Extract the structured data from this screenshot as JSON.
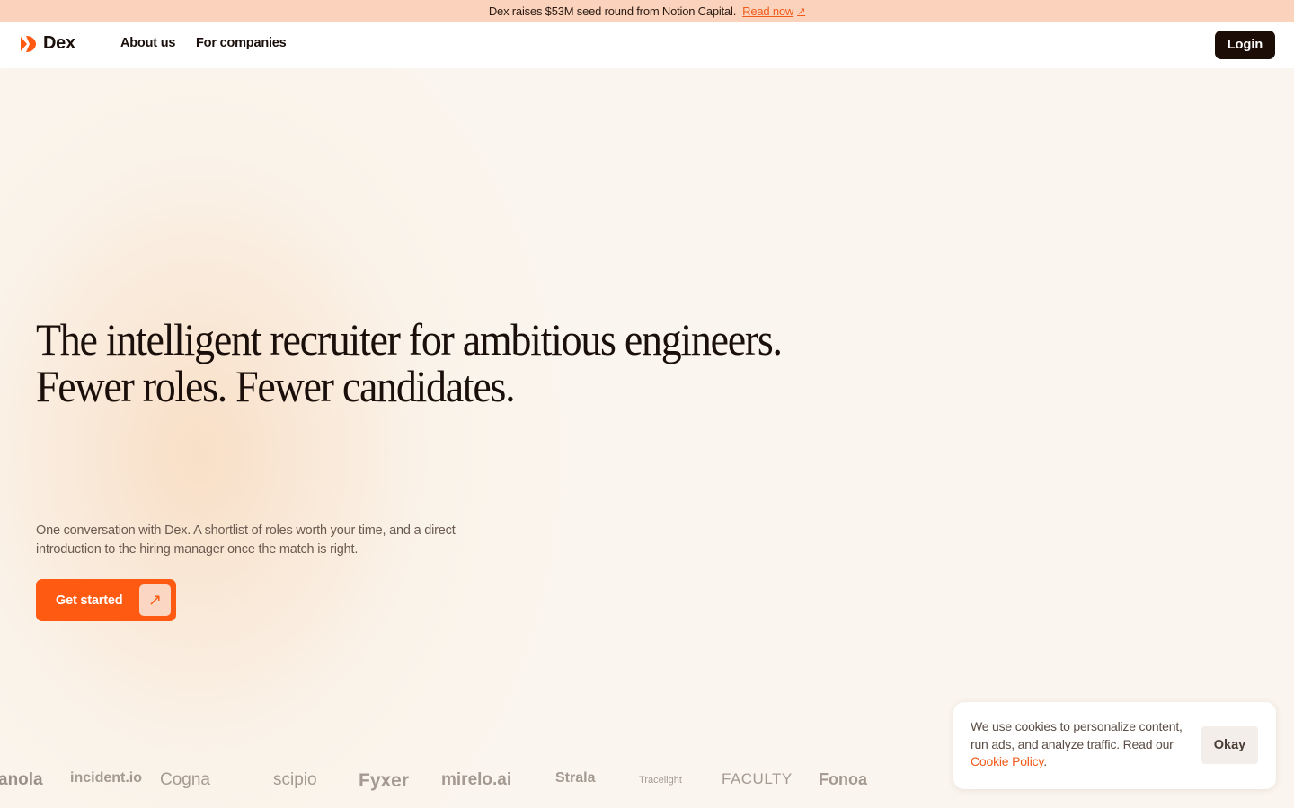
{
  "banner": {
    "message": "Dex raises $53M seed round from Notion Capital.",
    "link_label": "Read now",
    "link_icon": "arrow-up-right-icon"
  },
  "nav": {
    "brand": "Dex",
    "brand_icon": "dex-logo-icon",
    "links": [
      "About us",
      "For companies"
    ],
    "login_label": "Login"
  },
  "hero": {
    "headline_line1": "The intelligent recruiter for ambitious engineers.",
    "headline_line2": "Fewer roles. Fewer candidates.",
    "subtext": "One conversation with Dex. A shortlist of roles worth your time, and a direct introduction to the hiring manager once the match is right.",
    "cta_label": "Get started",
    "cta_icon": "arrow-up-right-icon"
  },
  "logos": [
    "anola",
    "incident.io",
    "Cogna",
    "scipio",
    "Fyxer",
    "mirelo.ai",
    "Strala",
    "Tracelight",
    "FACULTY",
    "Fonoa"
  ],
  "cookie": {
    "text": "We use cookies to personalize content, run ads, and analyze traffic. Read our ",
    "link_label": "Cookie Policy",
    "trailing": ".",
    "button_label": "Okay"
  },
  "colors": {
    "accent": "#ff5a12",
    "banner_bg": "#fbd3bd",
    "dark": "#1c0d07",
    "page_bg": "#faf5ee"
  }
}
